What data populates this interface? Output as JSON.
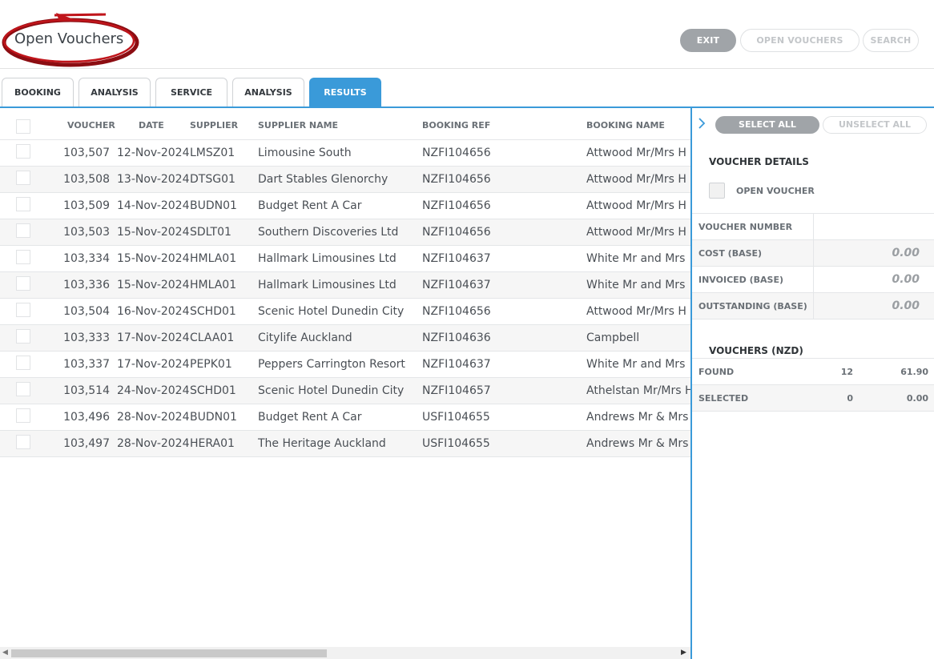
{
  "header": {
    "title": "Open Vouchers",
    "buttons": {
      "exit": "EXIT",
      "open_vouchers": "OPEN VOUCHERS",
      "search": "SEARCH"
    }
  },
  "tabs": [
    {
      "label": "BOOKING",
      "active": false
    },
    {
      "label": "ANALYSIS",
      "active": false
    },
    {
      "label": "SERVICE",
      "active": false
    },
    {
      "label": "ANALYSIS",
      "active": false
    },
    {
      "label": "RESULTS",
      "active": true
    }
  ],
  "grid": {
    "columns": {
      "voucher": "VOUCHER",
      "date": "DATE",
      "supplier": "SUPPLIER",
      "supplier_name": "SUPPLIER NAME",
      "booking_ref": "BOOKING REF",
      "booking_name": "BOOKING NAME"
    },
    "rows": [
      {
        "voucher": "103,507",
        "date": "12-Nov-2024",
        "supplier": "LMSZ01",
        "supplier_name": "Limousine South",
        "booking_ref": "NZFI104656",
        "booking_name": "Attwood Mr/Mrs H"
      },
      {
        "voucher": "103,508",
        "date": "13-Nov-2024",
        "supplier": "DTSG01",
        "supplier_name": "Dart Stables Glenorchy",
        "booking_ref": "NZFI104656",
        "booking_name": "Attwood Mr/Mrs H"
      },
      {
        "voucher": "103,509",
        "date": "14-Nov-2024",
        "supplier": "BUDN01",
        "supplier_name": "Budget Rent A Car",
        "booking_ref": "NZFI104656",
        "booking_name": "Attwood Mr/Mrs H"
      },
      {
        "voucher": "103,503",
        "date": "15-Nov-2024",
        "supplier": "SDLT01",
        "supplier_name": "Southern Discoveries Ltd",
        "booking_ref": "NZFI104656",
        "booking_name": "Attwood Mr/Mrs H"
      },
      {
        "voucher": "103,334",
        "date": "15-Nov-2024",
        "supplier": "HMLA01",
        "supplier_name": "Hallmark Limousines Ltd",
        "booking_ref": "NZFI104637",
        "booking_name": "White Mr and Mrs"
      },
      {
        "voucher": "103,336",
        "date": "15-Nov-2024",
        "supplier": "HMLA01",
        "supplier_name": "Hallmark Limousines Ltd",
        "booking_ref": "NZFI104637",
        "booking_name": "White Mr and Mrs"
      },
      {
        "voucher": "103,504",
        "date": "16-Nov-2024",
        "supplier": "SCHD01",
        "supplier_name": "Scenic Hotel Dunedin City",
        "booking_ref": "NZFI104656",
        "booking_name": "Attwood Mr/Mrs H"
      },
      {
        "voucher": "103,333",
        "date": "17-Nov-2024",
        "supplier": "CLAA01",
        "supplier_name": "Citylife Auckland",
        "booking_ref": "NZFI104636",
        "booking_name": "Campbell"
      },
      {
        "voucher": "103,337",
        "date": "17-Nov-2024",
        "supplier": "PEPK01",
        "supplier_name": "Peppers Carrington Resort",
        "booking_ref": "NZFI104637",
        "booking_name": "White Mr and Mrs"
      },
      {
        "voucher": "103,514",
        "date": "24-Nov-2024",
        "supplier": "SCHD01",
        "supplier_name": "Scenic Hotel Dunedin City",
        "booking_ref": "NZFI104657",
        "booking_name": "Athelstan Mr/Mrs H"
      },
      {
        "voucher": "103,496",
        "date": "28-Nov-2024",
        "supplier": "BUDN01",
        "supplier_name": "Budget Rent A Car",
        "booking_ref": "USFI104655",
        "booking_name": "Andrews Mr & Mrs B"
      },
      {
        "voucher": "103,497",
        "date": "28-Nov-2024",
        "supplier": "HERA01",
        "supplier_name": "The Heritage Auckland",
        "booking_ref": "USFI104655",
        "booking_name": "Andrews Mr & Mrs B"
      }
    ]
  },
  "panel": {
    "select_all": "SELECT ALL",
    "unselect_all": "UNSELECT ALL",
    "voucher_details_title": "VOUCHER DETAILS",
    "open_voucher_label": "OPEN VOUCHER",
    "details": [
      {
        "label": "VOUCHER NUMBER",
        "value": ""
      },
      {
        "label": "COST (BASE)",
        "value": "0.00"
      },
      {
        "label": "INVOICED (BASE)",
        "value": "0.00"
      },
      {
        "label": "OUTSTANDING (BASE)",
        "value": "0.00"
      }
    ],
    "summary_title": "VOUCHERS (NZD)",
    "summary": [
      {
        "label": "FOUND",
        "count": "12",
        "amount": "61.90"
      },
      {
        "label": "SELECTED",
        "count": "0",
        "amount": "0.00"
      }
    ]
  },
  "colors": {
    "accent": "#3a9ad9",
    "logo_ring": "#c0151b"
  },
  "icons": [
    "expand-chevron-icon",
    "scroll-left-icon",
    "scroll-right-icon"
  ]
}
